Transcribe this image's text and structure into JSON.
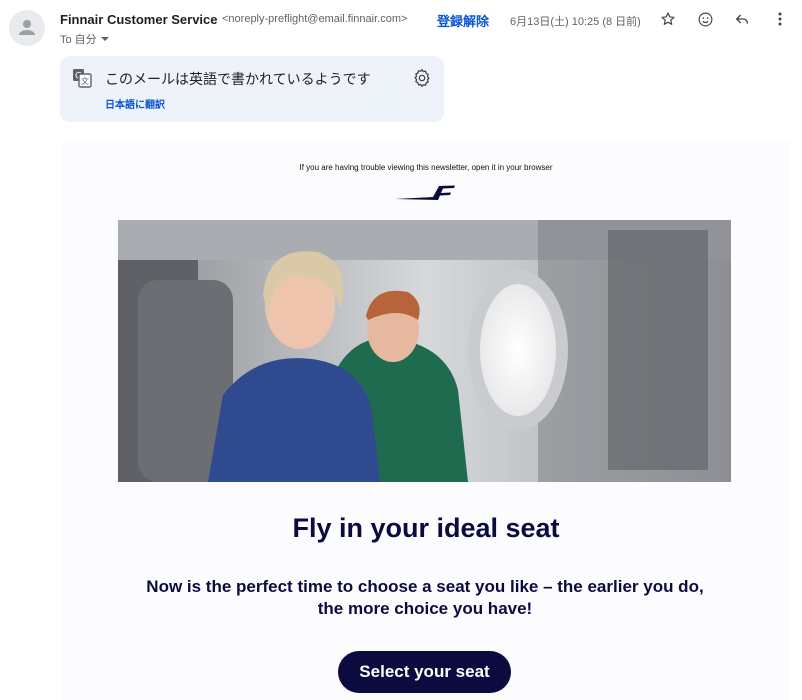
{
  "header": {
    "sender_name": "Finnair Customer Service",
    "sender_email": "<noreply-preflight@email.finnair.com>",
    "unsubscribe": "登録解除",
    "date": "6月13日(土) 10:25 (8 日前)",
    "to": "To 自分",
    "icons": [
      "star-icon",
      "emoji-icon",
      "reply-icon",
      "more-vert-icon"
    ]
  },
  "translate": {
    "message": "このメールは英語で書かれているようです",
    "link": "日本語に翻訳"
  },
  "newsletter": {
    "browser_notice": "If you are having trouble viewing this newsletter, open it in your browser",
    "headline": "Fly in your ideal seat",
    "subtext": "Now is the perfect time to choose a seat you like – the earlier you do, the more choice you have!",
    "cta": "Select your seat",
    "brand_color": "#0c0b3f"
  }
}
